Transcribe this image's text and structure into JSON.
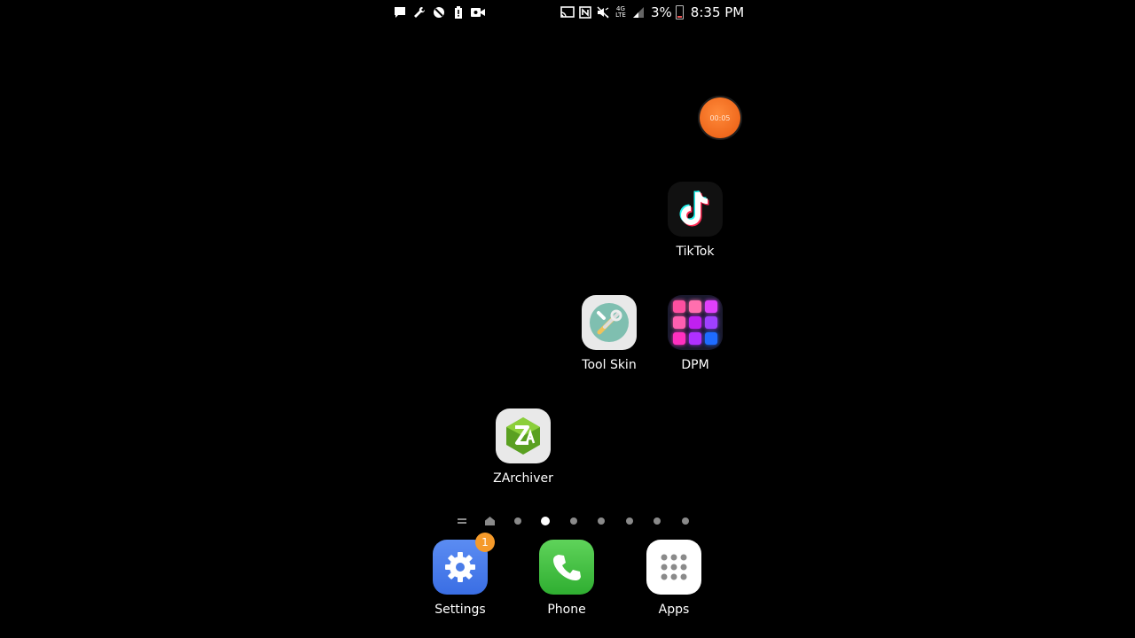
{
  "status_bar": {
    "left_icons": [
      "message-icon",
      "wrench-icon",
      "blocked-icon",
      "battery-alert-icon",
      "video-record-icon"
    ],
    "right_icons": [
      "cast-icon",
      "nfc-icon",
      "mute-icon"
    ],
    "network_label": "4G LTE",
    "battery_percent": "3%",
    "time": "8:35 PM"
  },
  "recorder": {
    "timer": "00:05",
    "color": "#f07020"
  },
  "home_apps": [
    {
      "label": "TikTok"
    },
    {
      "label": "Tool Skin"
    },
    {
      "label": "DPM"
    },
    {
      "label": "ZArchiver"
    }
  ],
  "page_indicator": {
    "count": 9,
    "active_index": 3
  },
  "dock": {
    "settings": {
      "label": "Settings",
      "badge": "1"
    },
    "phone": {
      "label": "Phone"
    },
    "apps": {
      "label": "Apps"
    }
  },
  "colors": {
    "background": "#000000",
    "badge": "#f59a2a",
    "dpm_tiles": [
      "#ff4fa0",
      "#ff6fae",
      "#e040fb",
      "#ff5fb0",
      "#c020f0",
      "#a040ff",
      "#ff30c0",
      "#b030ff",
      "#1e6bff"
    ]
  }
}
